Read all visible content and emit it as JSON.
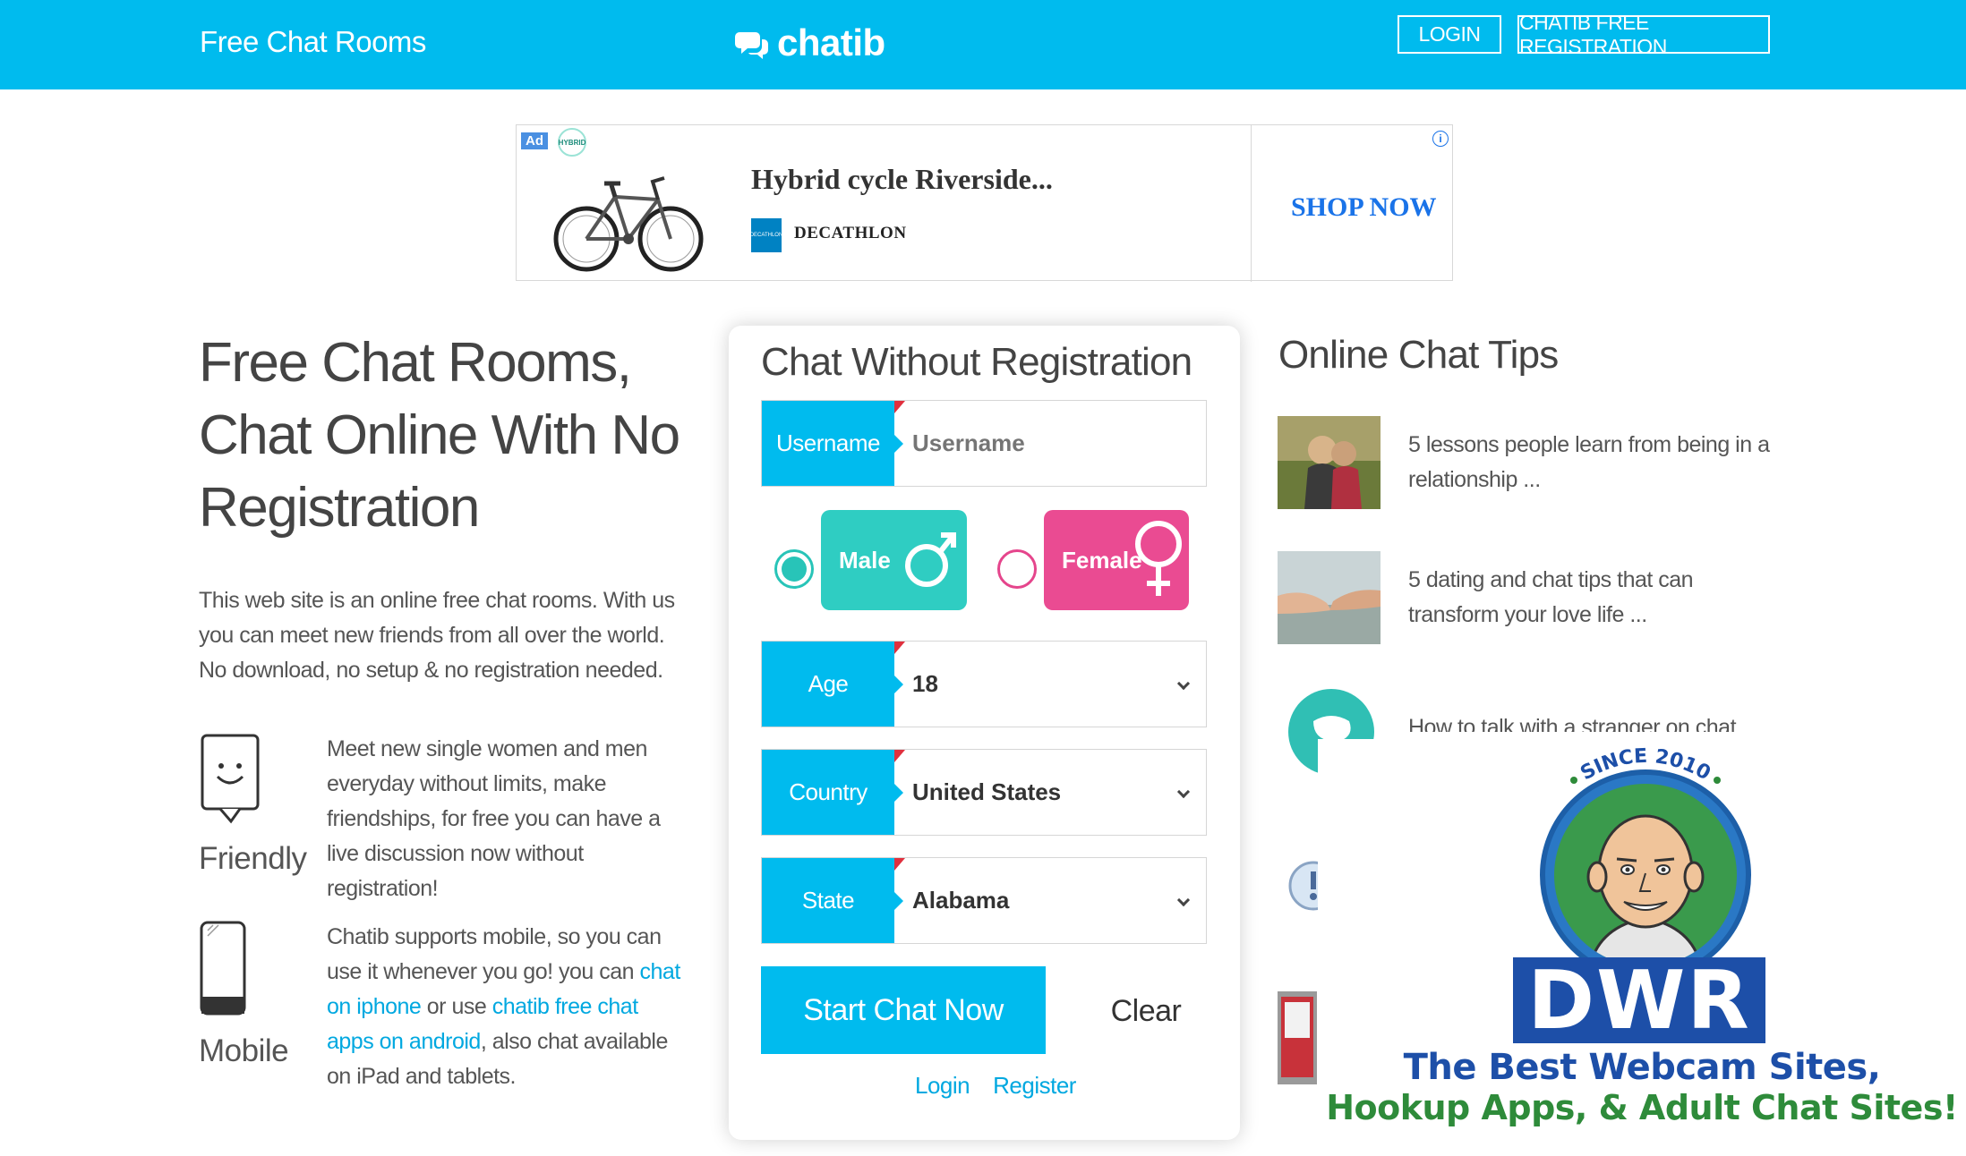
{
  "header": {
    "brand_link": "Free Chat Rooms",
    "logo_text": "chatib",
    "login_label": "LOGIN",
    "register_label": "CHATIB FREE REGISTRATION",
    "bg_color": "#00bbee"
  },
  "ad": {
    "badge": "Ad",
    "hybrid_badge": "HYBRID",
    "title": "Hybrid cycle Riverside...",
    "brand_logo": "DECATHLON",
    "brand": "DECATHLON",
    "cta": "SHOP NOW",
    "info_icon": "i"
  },
  "hero": {
    "title": "Free Chat Rooms, Chat Online With No Registration",
    "intro": "This web site is an online free chat rooms. With us you can meet new friends from all over the world. No download, no setup & no registration needed."
  },
  "features": {
    "friendly": {
      "label": "Friendly",
      "text": "Meet new single women and men everyday without limits, make friendships, for free you can have a live discussion now without registration!",
      "icon": "smiley-chat-icon"
    },
    "mobile": {
      "label": "Mobile",
      "text_1": "Chatib supports mobile, so you can use it whenever you go! you can ",
      "link_1": "chat on iphone",
      "text_2": " or use ",
      "link_2": "chatib free chat apps on android",
      "text_3": ", also chat available on iPad and tablets.",
      "icon": "mobile-phone-icon"
    }
  },
  "form": {
    "title": "Chat Without Registration",
    "username_label": "Username",
    "username_placeholder": "Username",
    "gender_male": "Male",
    "gender_female": "Female",
    "selected_gender": "Male",
    "age_label": "Age",
    "age_value": "18",
    "country_label": "Country",
    "country_value": "United States",
    "state_label": "State",
    "state_value": "Alabama",
    "start_label": "Start Chat Now",
    "clear_label": "Clear",
    "login_link": "Login",
    "register_link": "Register",
    "male_color": "#2fcdc2",
    "female_color": "#ea4b92"
  },
  "tips": {
    "title": "Online Chat Tips",
    "items": [
      {
        "text": "5 lessons people learn from being in a relationship ..."
      },
      {
        "text": "5 dating and chat tips that can transform your love life ..."
      },
      {
        "text": "How to talk with a stranger on chat rooms"
      }
    ]
  },
  "overlay": {
    "since": "SINCE 2010",
    "letters": "DWR",
    "line1": "The Best Webcam Sites,",
    "line2": "Hookup Apps, & Adult Chat Sites!",
    "blue": "#1d4fa8",
    "green": "#2e8b3a"
  }
}
